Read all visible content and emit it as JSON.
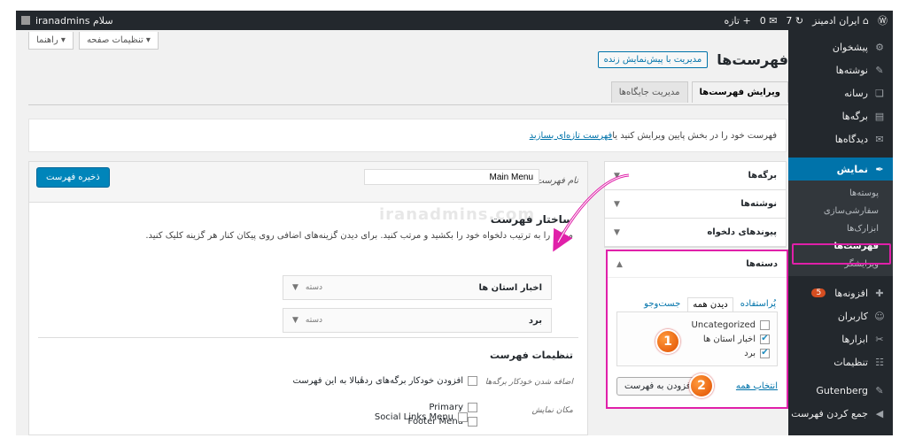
{
  "adminbar": {
    "wp_logo": "wordpress-icon",
    "site_name": "ایران ادمینز",
    "updates_count": "7",
    "comments_count": "0",
    "new_label": "تازه",
    "greeting": "سلام iranadmins"
  },
  "sidebar": {
    "items": [
      {
        "icon": "⚙",
        "label": "پیشخوان"
      },
      {
        "icon": "✎",
        "label": "نوشته‌ها"
      },
      {
        "icon": "❏",
        "label": "رسانه"
      },
      {
        "icon": "▤",
        "label": "برگه‌ها"
      },
      {
        "icon": "✉",
        "label": "دیدگاه‌ها"
      }
    ],
    "active": {
      "icon": "✒",
      "label": "نمایش"
    },
    "sub_items": [
      "پوسته‌ها",
      "سفارشی‌سازی",
      "ابزارک‌ها",
      "فهرست‌ها",
      "ویرایشگر"
    ],
    "current_sub": "فهرست‌ها",
    "items_after": [
      {
        "icon": "✚",
        "label": "افزونه‌ها",
        "badge": "5"
      },
      {
        "icon": "☺",
        "label": "کاربران"
      },
      {
        "icon": "✂",
        "label": "ابزارها"
      },
      {
        "icon": "☷",
        "label": "تنظیمات"
      },
      {
        "icon": "✎",
        "label": "Gutenberg"
      },
      {
        "icon": "◀",
        "label": "جمع کردن فهرست"
      }
    ]
  },
  "screen_options": {
    "help_label": "راهنما ▾",
    "options_label": "تنظیمات صفحه ▾"
  },
  "page": {
    "title": "فهرست‌ها",
    "live_preview_button": "مدیریت با پیش‌نمایش زنده",
    "tabs": [
      "ویرایش فهرست‌ها",
      "مدیریت جایگاه‌ها"
    ],
    "notice_prefix": "فهرست خود را در بخش پایین ویرایش کنید یا ",
    "notice_link": "فهرست تازه‌ای بسازید"
  },
  "accordion": {
    "sections": [
      "برگه‌ها",
      "نوشته‌ها",
      "پیوندهای دلخواه"
    ],
    "categories": {
      "title": "دسته‌ها",
      "tabs": [
        "پُراستفاده",
        "دیدن همه",
        "جست‌وجو"
      ],
      "active_tab": "دیدن همه",
      "items": [
        {
          "label": "Uncategorized",
          "checked": false
        },
        {
          "label": "اخبار استان ها",
          "checked": true
        },
        {
          "label": "برد",
          "checked": true
        }
      ],
      "select_all": "انتخاب همه",
      "add_button": "افزودن به فهرست"
    }
  },
  "menu": {
    "name_label": "نام فهرست",
    "name_value": "Main Menu",
    "save_button": "ذخیره فهرست",
    "structure_title": "ساختار فهرست",
    "structure_desc": "موارد را به ترتیب دلخواه خود را بکشید و مرتب کنید. برای دیدن گزینه‌های اضافی روی پیکان کنار هر گزینه کلیک کنید.",
    "items": [
      {
        "title": "اخبار استان ها",
        "type": "دسته"
      },
      {
        "title": "برد",
        "type": "دسته"
      }
    ],
    "settings_title": "تنظیمات فهرست",
    "auto_add_label": "اضافه شدن خودکار برگه‌ها",
    "auto_add_option": "افزودن خودکار برگه‌های ردهٔبالا به این فهرست",
    "location_label": "مکان نمایش",
    "locations": [
      "Primary",
      "Footer Menu",
      "Social Links Menu"
    ]
  },
  "annotations": {
    "step1": "1",
    "step2": "2"
  },
  "watermark": "iranadmins.com",
  "colors": {
    "accent": "#0073aa",
    "highlight": "#e020a9",
    "adminbar": "#23282d",
    "badge": "#d54e21"
  }
}
